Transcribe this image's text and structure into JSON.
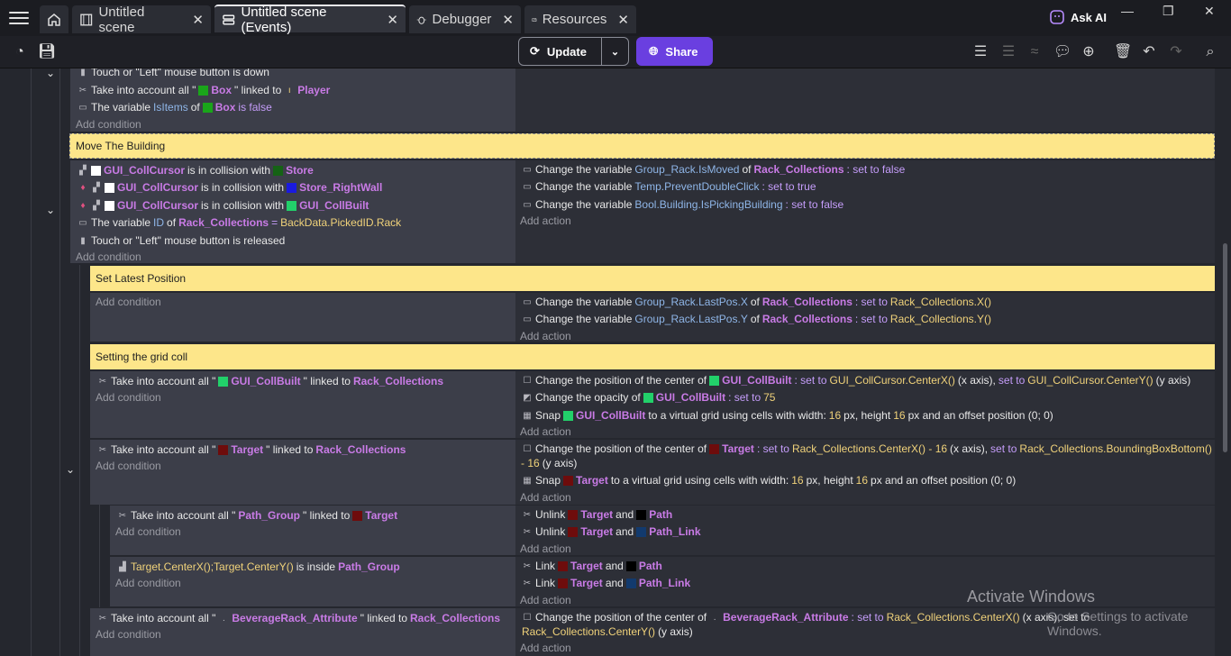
{
  "tabs": [
    {
      "label": "Untitled scene"
    },
    {
      "label": "Untitled scene (Events)"
    },
    {
      "label": "Debugger"
    },
    {
      "label": "Resources"
    }
  ],
  "ask_ai": "Ask AI",
  "toolbar": {
    "update": "Update",
    "share": "Share"
  },
  "top_event": {
    "c1": "Touch or \"Left\" mouse button is down",
    "c2_pre": "Take into account all \"",
    "c2_obj": "Box",
    "c2_mid": "\" linked to",
    "c2_obj2": "Player",
    "c3_pre": "The variable",
    "c3_var": "IsItems",
    "c3_mid": "of",
    "c3_obj": "Box",
    "c3_post": "is false",
    "add_condition": "Add condition"
  },
  "move_building": {
    "comment": "Move The Building",
    "conds": [
      {
        "obj": "GUI_CollCursor",
        "mid": "is in collision with",
        "obj2": "Store"
      },
      {
        "obj": "GUI_CollCursor",
        "mid": "is in collision with",
        "obj2": "Store_RightWall"
      },
      {
        "obj": "GUI_CollCursor",
        "mid": "is in collision with",
        "obj2": "GUI_CollBuilt"
      }
    ],
    "c4_pre": "The variable",
    "c4_var": "ID",
    "c4_mid": "of",
    "c4_obj": "Rack_Collections",
    "c4_eq": "=",
    "c4_val": "BackData.PickedID.Rack",
    "c5": "Touch or \"Left\" mouse button is released",
    "add_condition": "Add condition",
    "actions": [
      {
        "pre": "Change the variable",
        "var": "Group_Rack.IsMoved",
        "mid": "of",
        "obj": "Rack_Collections",
        "set": ": set to false"
      },
      {
        "pre": "Change the variable",
        "var": "Temp.PreventDoubleClick",
        "set": ": set to true"
      },
      {
        "pre": "Change the variable",
        "var": "Bool.Building.IsPickingBuilding",
        "set": ": set to false"
      }
    ],
    "add_action": "Add action"
  },
  "latest_pos": {
    "comment": "Set Latest Position",
    "add_condition": "Add condition",
    "actions": [
      {
        "pre": "Change the variable",
        "var": "Group_Rack.LastPos.X",
        "mid": "of",
        "obj": "Rack_Collections",
        "set": ": set to",
        "val": "Rack_Collections.X()"
      },
      {
        "pre": "Change the variable",
        "var": "Group_Rack.LastPos.Y",
        "mid": "of",
        "obj": "Rack_Collections",
        "set": ": set to",
        "val": "Rack_Collections.Y()"
      }
    ],
    "add_action": "Add action"
  },
  "grid": {
    "comment": "Setting the grid coll",
    "e1": {
      "c_pre": "Take into account all \"",
      "c_obj": "GUI_CollBuilt",
      "c_mid": "\" linked to",
      "c_obj2": "Rack_Collections",
      "add_condition": "Add condition",
      "a1_pre": "Change the position of the center of",
      "a1_obj": "GUI_CollBuilt",
      "a1_set": ": set to",
      "a1_val": "GUI_CollCursor.CenterX()",
      "a1_x": "(x axis),",
      "a1_set2": "set to",
      "a1_val2": "GUI_CollCursor.CenterY()",
      "a1_y": "(y axis)",
      "a2_pre": "Change the opacity of",
      "a2_obj": "GUI_CollBuilt",
      "a2_set": ": set to",
      "a2_val": "75",
      "a3_pre": "Snap",
      "a3_obj": "GUI_CollBuilt",
      "a3_mid": "to a virtual grid using cells with width:",
      "a3_w": "16",
      "a3_mid2": "px, height",
      "a3_h": "16",
      "a3_post": "px and an offset position (0; 0)",
      "add_action": "Add action"
    },
    "e2": {
      "c_pre": "Take into account all \"",
      "c_obj": "Target",
      "c_mid": "\" linked to",
      "c_obj2": "Rack_Collections",
      "add_condition": "Add condition",
      "a1_pre": "Change the position of the center of",
      "a1_obj": "Target",
      "a1_set": ": set to",
      "a1_val": "Rack_Collections.CenterX() - 16",
      "a1_x": "(x axis),",
      "a1_set2": "set to",
      "a1_val2": "Rack_Collections.BoundingBoxBottom()",
      "a1_cont": "- 16",
      "a1_y": "(y axis)",
      "a2_pre": "Snap",
      "a2_obj": "Target",
      "a2_mid": "to a virtual grid using cells with width:",
      "a2_w": "16",
      "a2_mid2": "px, height",
      "a2_h": "16",
      "a2_post": "px and an offset position (0; 0)",
      "add_action": "Add action"
    },
    "e3": {
      "c_pre": "Take into account all \"",
      "c_obj": "Path_Group",
      "c_mid": "\" linked to",
      "c_obj2": "Target",
      "add_condition": "Add condition",
      "a1_pre": "Unlink",
      "a1_obj": "Target",
      "a1_mid": "and",
      "a1_obj2": "Path",
      "a2_pre": "Unlink",
      "a2_obj": "Target",
      "a2_mid": "and",
      "a2_obj2": "Path_Link",
      "add_action": "Add action"
    },
    "e4": {
      "c_val": "Target.CenterX();Target.CenterY()",
      "c_mid": "is inside",
      "c_obj": "Path_Group",
      "add_condition": "Add condition",
      "a1_pre": "Link",
      "a1_obj": "Target",
      "a1_mid": "and",
      "a1_obj2": "Path",
      "a2_pre": "Link",
      "a2_obj": "Target",
      "a2_mid": "and",
      "a2_obj2": "Path_Link",
      "add_action": "Add action"
    },
    "e5": {
      "c_pre": "Take into account all \"",
      "c_obj": "BeverageRack_Attribute",
      "c_mid": "\" linked to",
      "c_obj2": "Rack_Collections",
      "add_condition": "Add condition",
      "a1_pre": "Change the position of the center of",
      "a1_obj": "BeverageRack_Attribute",
      "a1_set": ": set to",
      "a1_val": "Rack_Collections.CenterX()",
      "a1_x": "(x axis), set to",
      "a1_val2": "Rack_Collections.CenterY()",
      "a1_y": "(y axis)",
      "add_action": "Add action"
    }
  },
  "watermark": {
    "line1": "Activate Windows",
    "line2": "Go to Settings to activate Windows."
  }
}
